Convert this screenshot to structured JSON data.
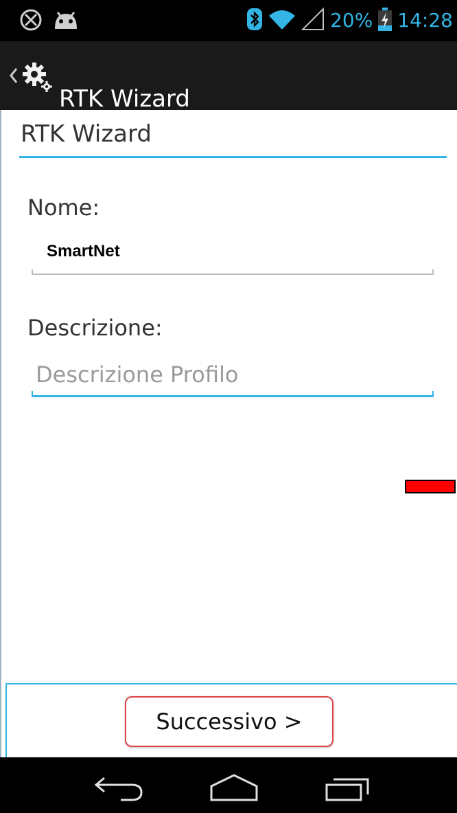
{
  "status_bar": {
    "battery_percent": "20%",
    "time": "14:28",
    "icons": [
      "crosshair-icon",
      "android-icon",
      "bluetooth-icon",
      "wifi-icon",
      "signal-icon",
      "battery-charging-icon"
    ],
    "accent_color": "#33b5e5"
  },
  "action_bar": {
    "title": "RTK Wizard",
    "icons": [
      "back-caret-icon",
      "settings-gears-icon"
    ]
  },
  "dialog": {
    "title": "RTK Wizard",
    "name_label": "Nome:",
    "name_value": "SmartNet",
    "description_label": "Descrizione:",
    "description_placeholder": "Descrizione Profilo",
    "next_button": "Successivo >"
  },
  "nav_bar": {
    "icons": [
      "back-icon",
      "home-icon",
      "recents-icon"
    ]
  },
  "colors": {
    "accent": "#33b5e5",
    "highlight": "#e0444a",
    "marker": "#ff0000"
  }
}
